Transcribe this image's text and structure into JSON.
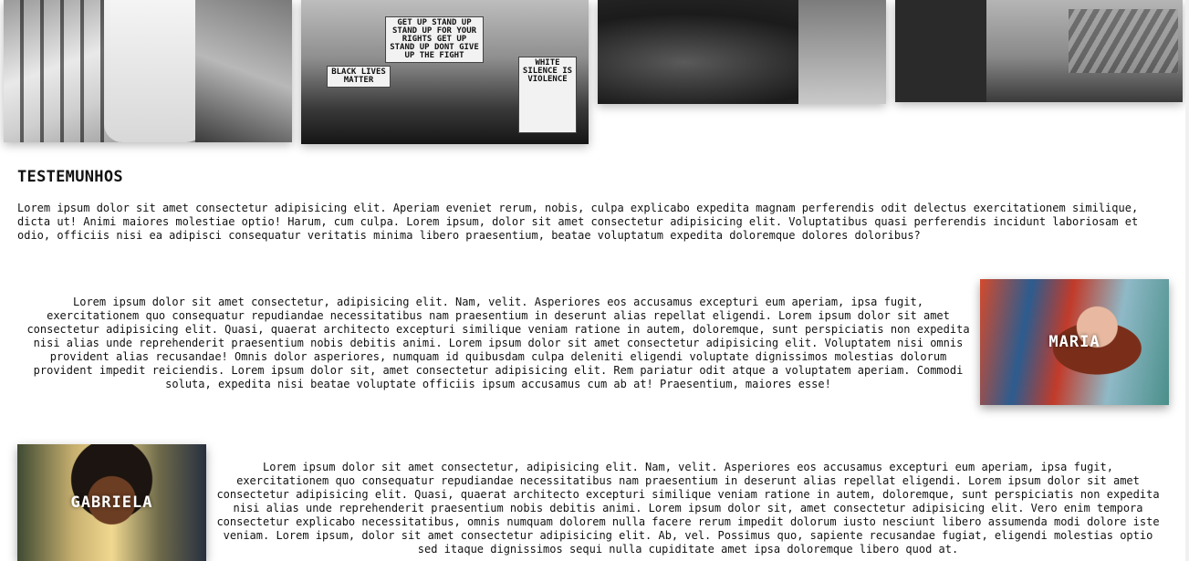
{
  "gallery": {
    "photo2_signs": {
      "sign_top": "GET UP STAND UP STAND UP FOR YOUR RIGHTS GET UP STAND UP DONT GIVE UP THE FIGHT",
      "sign_left": "BLACK LIVES MATTER",
      "sign_right": "WHITE SILENCE IS VIOLENCE"
    }
  },
  "section": {
    "title": "TESTEMUNHOS",
    "intro": "Lorem ipsum dolor sit amet consectetur adipisicing elit. Aperiam eveniet rerum, nobis, culpa explicabo expedita magnam perferendis odit delectus exercitationem similique, dicta ut! Animi maiores molestiae optio! Harum, cum culpa. Lorem ipsum, dolor sit amet consectetur adipisicing elit. Voluptatibus quasi perferendis incidunt laboriosam et odio, officiis nisi ea adipisci consequatur veritatis minima libero praesentium, beatae voluptatum expedita doloremque dolores doloribus?"
  },
  "testimonials": [
    {
      "name": "MARIA",
      "text": "Lorem ipsum dolor sit amet consectetur, adipisicing elit. Nam, velit. Asperiores eos accusamus excepturi eum aperiam, ipsa fugit, exercitationem quo consequatur repudiandae necessitatibus nam praesentium in deserunt alias repellat eligendi. Lorem ipsum dolor sit amet consectetur adipisicing elit. Quasi, quaerat architecto excepturi similique veniam ratione in autem, doloremque, sunt perspiciatis non expedita nisi alias unde reprehenderit praesentium nobis debitis animi. Lorem ipsum dolor sit amet consectetur adipisicing elit. Voluptatem nisi omnis provident alias recusandae! Omnis dolor asperiores, numquam id quibusdam culpa deleniti eligendi voluptate dignissimos molestias dolorum provident impedit reiciendis. Lorem ipsum dolor sit, amet consectetur adipisicing elit. Rem pariatur odit atque a voluptatem aperiam. Commodi soluta, expedita nisi beatae voluptate officiis ipsum accusamus cum ab at! Praesentium, maiores esse!"
    },
    {
      "name": "GABRIELA",
      "text": "Lorem ipsum dolor sit amet consectetur, adipisicing elit. Nam, velit. Asperiores eos accusamus excepturi eum aperiam, ipsa fugit, exercitationem quo consequatur repudiandae necessitatibus nam praesentium in deserunt alias repellat eligendi. Lorem ipsum dolor sit amet consectetur adipisicing elit. Quasi, quaerat architecto excepturi similique veniam ratione in autem, doloremque, sunt perspiciatis non expedita nisi alias unde reprehenderit praesentium nobis debitis animi. Lorem ipsum dolor sit, amet consectetur adipisicing elit. Vero enim tempora consectetur explicabo necessitatibus, omnis numquam dolorem nulla facere rerum impedit dolorum iusto nesciunt libero assumenda modi dolore iste veniam. Lorem ipsum, dolor sit amet consectetur adipisicing elit. Ab, vel. Possimus quo, sapiente recusandae fugiat, eligendi molestias optio sed itaque dignissimos sequi nulla cupiditate amet ipsa doloremque libero quod at."
    }
  ]
}
